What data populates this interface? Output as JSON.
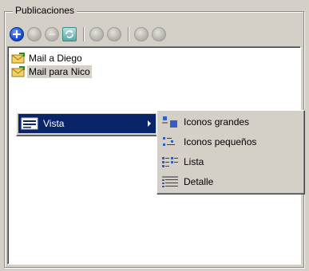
{
  "groupbox": {
    "title": "Publicaciones"
  },
  "toolbar": {
    "buttons": [
      {
        "icon": "add-icon",
        "enabled": true
      },
      {
        "icon": "circle-icon",
        "enabled": false
      },
      {
        "icon": "remove-icon",
        "enabled": false
      },
      {
        "icon": "refresh-icon",
        "enabled": true
      },
      {
        "icon": "circle-icon",
        "enabled": false
      },
      {
        "icon": "circle-icon",
        "enabled": false
      },
      {
        "icon": "circle-icon",
        "enabled": false
      },
      {
        "icon": "circle-icon",
        "enabled": false
      }
    ]
  },
  "list": {
    "items": [
      {
        "label": "Mail a Diego",
        "icon": "mail-icon",
        "selected": false
      },
      {
        "label": "Mail para Nico",
        "icon": "mail-icon",
        "selected": true
      }
    ]
  },
  "context_menu": {
    "items": [
      {
        "label": "Vista",
        "icon": "view-icon",
        "highlighted": true,
        "has_submenu": true
      }
    ]
  },
  "submenu": {
    "items": [
      {
        "label": "Iconos grandes",
        "icon": "large-icons-icon"
      },
      {
        "label": "Iconos pequeños",
        "icon": "small-icons-icon"
      },
      {
        "label": "Lista",
        "icon": "list-view-icon"
      },
      {
        "label": "Detalle",
        "icon": "details-view-icon"
      }
    ]
  },
  "colors": {
    "highlight": "#0a246a",
    "face": "#d4d0c8"
  }
}
